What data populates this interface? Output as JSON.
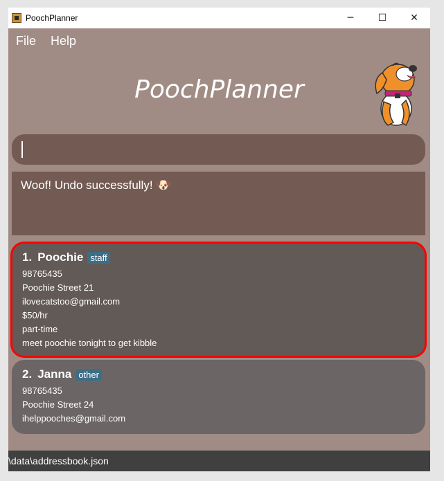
{
  "window": {
    "title": "PoochPlanner",
    "minimize": "─",
    "maximize": "☐",
    "close": "✕"
  },
  "menu": {
    "file": "File",
    "help": "Help"
  },
  "header": {
    "app_title": "PoochPlanner"
  },
  "command": {
    "value": ""
  },
  "result": {
    "message": "Woof! Undo successfully! 🐶"
  },
  "persons": [
    {
      "index": "1.",
      "name": "Poochie",
      "tag": "staff",
      "phone": "98765435",
      "address": "Poochie Street 21",
      "email": "ilovecatstoo@gmail.com",
      "rate": "$50/hr",
      "type": "part-time",
      "note": "meet poochie tonight to get kibble",
      "selected": true
    },
    {
      "index": "2.",
      "name": "Janna",
      "tag": "other",
      "phone": "98765435",
      "address": "Poochie Street 24",
      "email": "ihelppooches@gmail.com"
    }
  ],
  "status": {
    "path": "\\data\\addressbook.json"
  },
  "colors": {
    "window_bg": "#a08c85",
    "input_bg": "#735b53",
    "card_bg": "#615a57",
    "tag_bg": "#3d6e86",
    "selection": "#ff0000",
    "status_bg": "#404040"
  }
}
